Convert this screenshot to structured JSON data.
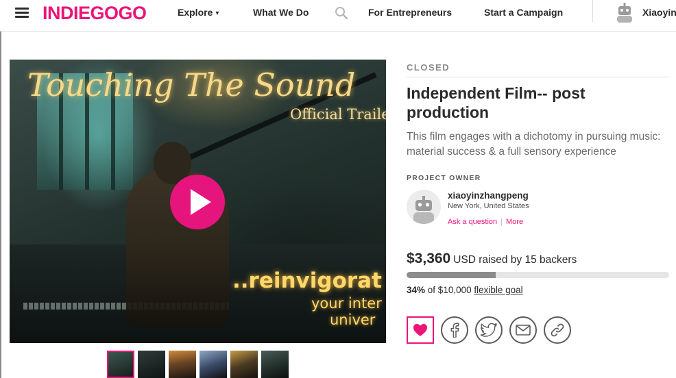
{
  "nav": {
    "logo": "INDIEGOGO",
    "explore": "Explore",
    "what_we_do": "What We Do",
    "for_entrepreneurs": "For Entrepreneurs",
    "start_campaign": "Start a Campaign",
    "user_name": "Xiaoyin"
  },
  "video": {
    "title_text": "Touching The Sound",
    "subtitle_text": "Official Traile",
    "caption_big": "..reinvigorat",
    "caption_line1": "your inter",
    "caption_line2": "univer"
  },
  "thumbnails": {
    "count": 6,
    "active_index": 0
  },
  "campaign": {
    "status": "CLOSED",
    "title": "Independent Film-- post production",
    "tagline": "This film engages with a dichotomy in pursuing music: material success & a full sensory experience",
    "owner_label": "PROJECT OWNER",
    "owner_name": "xiaoyinzhangpeng",
    "owner_location": "New York, United States",
    "ask_question": "Ask a question",
    "more": "More",
    "link_separator": "|",
    "amount_raised": "$3,360",
    "raised_text": "USD raised by 15 backers",
    "progress_fraction": 0.34,
    "percent": "34%",
    "goal_text": "of $10,000",
    "goal_type": "flexible goal"
  },
  "share": {
    "icons": [
      "heart-icon",
      "facebook-icon",
      "twitter-icon",
      "mail-icon",
      "link-icon"
    ]
  },
  "colors": {
    "brand": "#eb1478",
    "play_button": "#e6147d",
    "progress_fill": "#8c8c8c"
  }
}
